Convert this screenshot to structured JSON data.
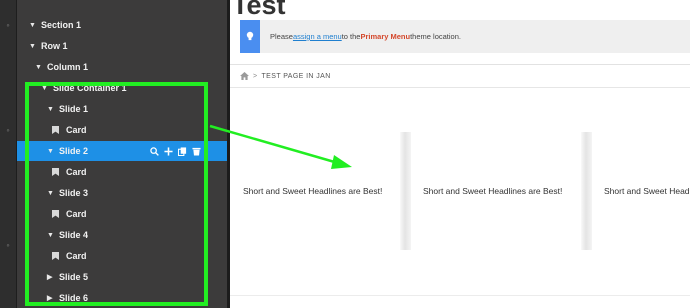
{
  "colors": {
    "panel_bg": "#3c3b3b",
    "active_row": "#1e90e6",
    "highlight": "#22ee22",
    "notice_accent": "#4a8ef0",
    "primary_menu": "#d4482c",
    "link": "#1f7fcf"
  },
  "tree": [
    {
      "label": "Section 1",
      "icon": "caret-down",
      "depth": 0,
      "active": false
    },
    {
      "label": "Row 1",
      "icon": "caret-down",
      "depth": 1,
      "active": false
    },
    {
      "label": "Column 1",
      "icon": "caret-down",
      "depth": 2,
      "active": false
    },
    {
      "label": "Slide Container 1",
      "icon": "caret-down",
      "depth": 3,
      "active": false
    },
    {
      "label": "Slide 1",
      "icon": "caret-down",
      "depth": 4,
      "active": false
    },
    {
      "label": "Card",
      "icon": "card-icon",
      "depth": 5,
      "active": false
    },
    {
      "label": "Slide 2",
      "icon": "caret-down",
      "depth": 4,
      "active": true
    },
    {
      "label": "Card",
      "icon": "card-icon",
      "depth": 5,
      "active": false
    },
    {
      "label": "Slide 3",
      "icon": "caret-down",
      "depth": 4,
      "active": false
    },
    {
      "label": "Card",
      "icon": "card-icon",
      "depth": 5,
      "active": false
    },
    {
      "label": "Slide 4",
      "icon": "caret-down",
      "depth": 4,
      "active": false
    },
    {
      "label": "Card",
      "icon": "card-icon",
      "depth": 5,
      "active": false
    },
    {
      "label": "Slide 5",
      "icon": "caret-right",
      "depth": 4,
      "active": false
    },
    {
      "label": "Slide 6",
      "icon": "caret-right",
      "depth": 4,
      "active": false
    }
  ],
  "active_row_actions": [
    "search-icon",
    "plus-icon",
    "duplicate-icon",
    "trash-icon"
  ],
  "preview": {
    "title": "Test",
    "notice": {
      "before": "Please ",
      "link": "assign a menu",
      "middle": " to the ",
      "strong": "Primary Menu",
      "after": " theme location."
    },
    "breadcrumb": {
      "separator": ">",
      "current": "TEST PAGE IN JAN"
    },
    "slides": [
      "Short and Sweet Headlines are Best!",
      "Short and Sweet Headlines are Best!",
      "Short and Sweet Headlines are Best!"
    ]
  }
}
